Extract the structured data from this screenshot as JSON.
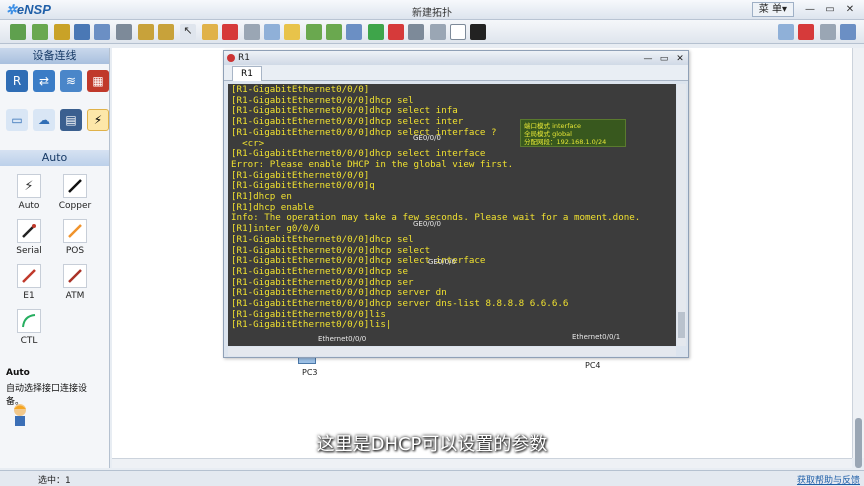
{
  "app": {
    "name": "eNSP",
    "window_title": "新建拓扑",
    "menu_label": "菜 单▾"
  },
  "left_panel": {
    "header": "设备连线",
    "section": "Auto",
    "cables": [
      {
        "label": "Auto",
        "icon": "auto-cable-icon",
        "color": "#333333"
      },
      {
        "label": "Copper",
        "icon": "copper-cable-icon",
        "color": "#111111"
      },
      {
        "label": "Serial",
        "icon": "serial-cable-icon",
        "color": "#222222"
      },
      {
        "label": "POS",
        "icon": "pos-cable-icon",
        "color": "#f0932b"
      },
      {
        "label": "E1",
        "icon": "e1-cable-icon",
        "color": "#c0392b"
      },
      {
        "label": "ATM",
        "icon": "atm-cable-icon",
        "color": "#a93226"
      },
      {
        "label": "CTL",
        "icon": "ctl-cable-icon",
        "color": "#27ae60"
      }
    ],
    "description_title": "Auto",
    "description_text": "自动选择接口连接设备。"
  },
  "topology": {
    "labels": {
      "ge_top": "GE0/0/0",
      "ge_mid": "GE0/0/0",
      "ge_sw": "GE0/0/0",
      "eth_pc3": "Ethernet0/0/0",
      "eth_pc4": "Ethernet0/0/1",
      "pc3": "PC3",
      "pc4": "PC4"
    },
    "green_box": {
      "line1": "端口模式 interface",
      "line2": "全局模式 global",
      "line3": "分配网段：192.168.1.0/24"
    }
  },
  "cli_window": {
    "title": "R1",
    "tab": "R1",
    "lines": [
      "[R1-GigabitEthernet0/0/0]",
      "[R1-GigabitEthernet0/0/0]dhcp sel",
      "[R1-GigabitEthernet0/0/0]dhcp select infa",
      "[R1-GigabitEthernet0/0/0]dhcp select inter",
      "[R1-GigabitEthernet0/0/0]dhcp select interface ?",
      "  <cr>",
      "",
      "[R1-GigabitEthernet0/0/0]dhcp select interface",
      "Error: Please enable DHCP in the global view first.",
      "[R1-GigabitEthernet0/0/0]",
      "[R1-GigabitEthernet0/0/0]q",
      "[R1]dhcp en",
      "[R1]dhcp enable",
      "Info: The operation may take a few seconds. Please wait for a moment.done.",
      "[R1]inter g0/0/0",
      "[R1-GigabitEthernet0/0/0]dhcp sel",
      "[R1-GigabitEthernet0/0/0]dhcp select",
      "[R1-GigabitEthernet0/0/0]dhcp select interface",
      "[R1-GigabitEthernet0/0/0]dhcp se",
      "[R1-GigabitEthernet0/0/0]dhcp ser",
      "[R1-GigabitEthernet0/0/0]dhcp server dn",
      "[R1-GigabitEthernet0/0/0]dhcp server dns-list 8.8.8.8 6.6.6.6",
      "[R1-GigabitEthernet0/0/0]lis",
      "[R1-GigabitEthernet0/0/0]lis|"
    ]
  },
  "caption": "这里是DHCP可以设置的参数",
  "status": {
    "selected": "选中：1",
    "help_link": "获取帮助与反馈"
  }
}
